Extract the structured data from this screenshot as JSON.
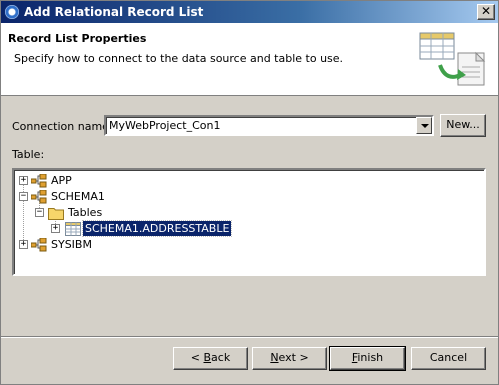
{
  "window": {
    "title": "Add Relational Record List",
    "close_symbol": "✕"
  },
  "banner": {
    "title": "Record List Properties",
    "description": "Specify how to connect to the data source and table to use."
  },
  "connection": {
    "label": "Connection name:",
    "value": "MyWebProject_Con1",
    "new_button": "New..."
  },
  "table": {
    "label": "Table:",
    "tree": [
      {
        "label": "APP",
        "expander": "+",
        "icon": "schema-icon"
      },
      {
        "label": "SCHEMA1",
        "expander": "−",
        "icon": "schema-icon"
      },
      {
        "label": "Tables",
        "expander": "−",
        "icon": "folder-icon"
      },
      {
        "label": "SCHEMA1.ADDRESSTABLE",
        "expander": "+",
        "icon": "table-icon",
        "selected": true
      },
      {
        "label": "SYSIBM",
        "expander": "+",
        "icon": "schema-icon"
      }
    ]
  },
  "buttons": {
    "back_mnemonic": "B",
    "back_rest": "ack",
    "back_prefix": "< ",
    "next_mnemonic": "N",
    "next_rest": "ext >",
    "finish_mnemonic": "F",
    "finish_rest": "inish",
    "cancel": "Cancel"
  },
  "colors": {
    "title_bar": "#0a246a",
    "selection": "#0a246a",
    "dialog_face": "#d4d0c8"
  }
}
